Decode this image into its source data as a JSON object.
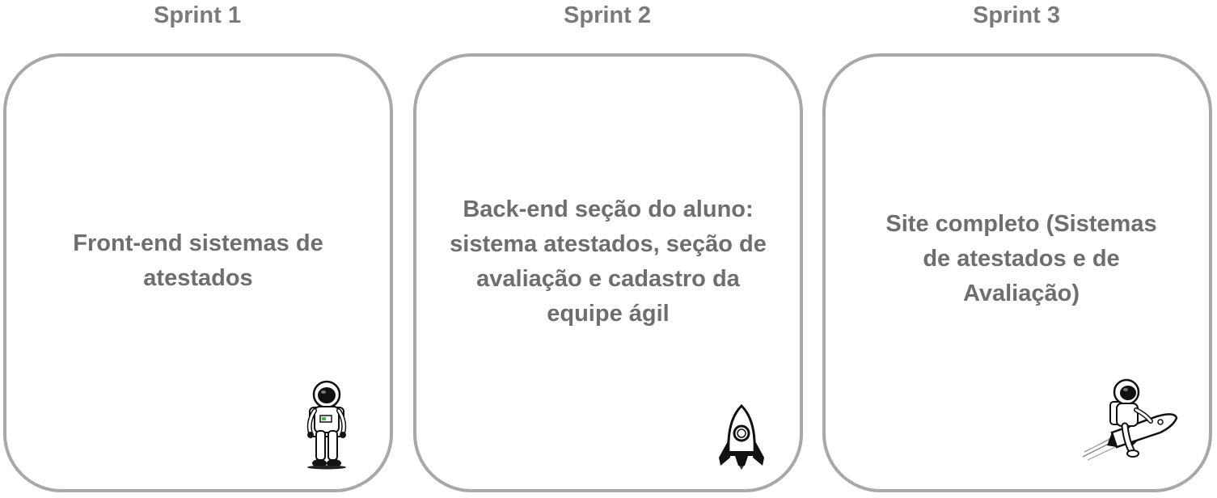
{
  "sprints": [
    {
      "title": "Sprint 1",
      "description": "Front-end sistemas de atestados",
      "illustration": "astronaut-standing-icon"
    },
    {
      "title": "Sprint 2",
      "description": "Back-end seção do aluno: sistema atestados, seção de avaliação e cadastro da equipe ágil",
      "illustration": "rocket-icon"
    },
    {
      "title": "Sprint 3",
      "description": "Site completo (Sistemas de atestados e de Avaliação)",
      "illustration": "astronaut-riding-rocket-icon"
    }
  ],
  "colors": {
    "title_text": "#7a7a7a",
    "body_text": "#6e6e6e",
    "card_border": "#a8a8a8"
  }
}
